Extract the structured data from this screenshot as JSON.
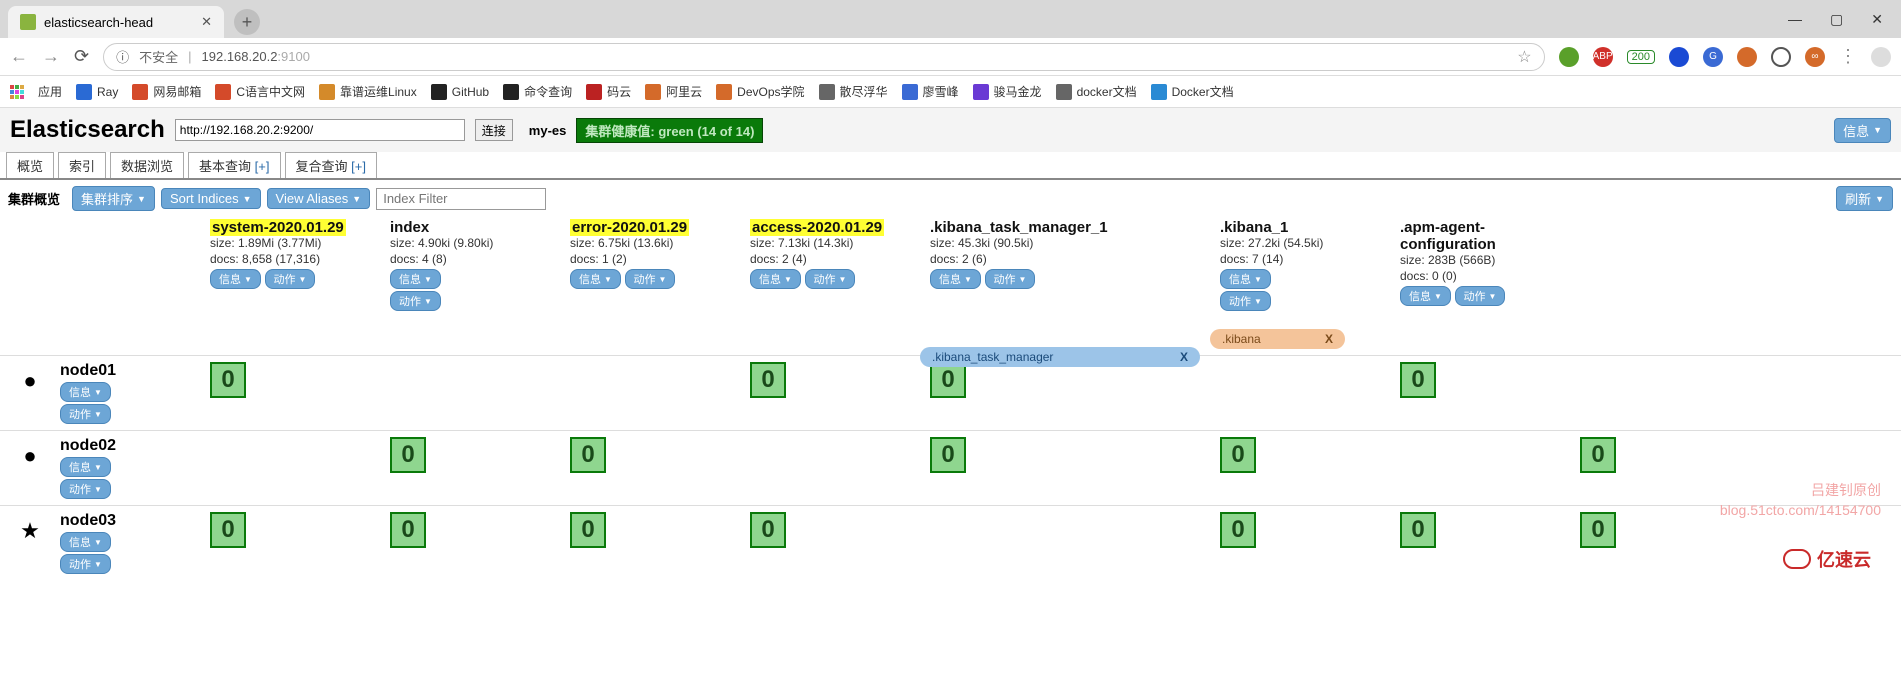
{
  "browser": {
    "tab_title": "elasticsearch-head",
    "url_warn": "不安全",
    "url_host": "192.168.20.2",
    "url_port": ":9100",
    "star": "☆",
    "ext_badge": "200",
    "bookmarks_label": "应用",
    "bookmarks": [
      {
        "label": "Ray",
        "color": "#2a6ad4"
      },
      {
        "label": "网易邮箱",
        "color": "#d44a2a"
      },
      {
        "label": "C语言中文网",
        "color": "#d44a2a"
      },
      {
        "label": "靠谱运维Linux",
        "color": "#d48a2a"
      },
      {
        "label": "GitHub",
        "color": "#222"
      },
      {
        "label": "命令查询",
        "color": "#222"
      },
      {
        "label": "码云",
        "color": "#b22"
      },
      {
        "label": "阿里云",
        "color": "#d46a2a"
      },
      {
        "label": "DevOps学院",
        "color": "#d46a2a"
      },
      {
        "label": "散尽浮华",
        "color": "#666"
      },
      {
        "label": "廖雪峰",
        "color": "#3a6ad4"
      },
      {
        "label": "骏马金龙",
        "color": "#6a3ad4"
      },
      {
        "label": "docker文档",
        "color": "#666"
      },
      {
        "label": "Docker文档",
        "color": "#2a8ad4"
      }
    ]
  },
  "es": {
    "title": "Elasticsearch",
    "url": "http://192.168.20.2:9200/",
    "connect": "连接",
    "cluster": "my-es",
    "health": "集群健康值: green (14 of 14)",
    "info_btn": "信息",
    "tabs": [
      "概览",
      "索引",
      "数据浏览",
      "基本查询 [+]",
      "复合查询 [+]"
    ],
    "controls": {
      "label": "集群概览",
      "sort_cluster": "集群排序",
      "sort_indices": "Sort Indices",
      "view_aliases": "View Aliases",
      "filter_placeholder": "Index Filter",
      "refresh": "刷新"
    },
    "btn_info": "信息",
    "btn_action": "动作",
    "indices": [
      {
        "name": "system-2020.01.29",
        "hl": true,
        "size": "size: 1.89Mi (3.77Mi)",
        "docs": "docs: 8,658 (17,316)",
        "both": true
      },
      {
        "name": "index",
        "hl": false,
        "size": "size: 4.90ki (9.80ki)",
        "docs": "docs: 4 (8)",
        "both": false
      },
      {
        "name": "error-2020.01.29",
        "hl": true,
        "size": "size: 6.75ki (13.6ki)",
        "docs": "docs: 1 (2)",
        "both": true
      },
      {
        "name": "access-2020.01.29",
        "hl": true,
        "size": "size: 7.13ki (14.3ki)",
        "docs": "docs: 2 (4)",
        "both": true
      },
      {
        "name": ".kibana_task_manager_1",
        "hl": false,
        "size": "size: 45.3ki (90.5ki)",
        "docs": "docs: 2 (6)",
        "both": true,
        "wide": true
      },
      {
        "name": ".kibana_1",
        "hl": false,
        "size": "size: 27.2ki (54.5ki)",
        "docs": "docs: 7 (14)",
        "both": false,
        "extra_action": true
      },
      {
        "name": ".apm-agent-configuration",
        "hl": false,
        "size": "size: 283B (566B)",
        "docs": "docs: 0 (0)",
        "both": true
      }
    ],
    "aliases": [
      {
        "name": ".kibana_task_manager",
        "x": "X"
      },
      {
        "name": ".kibana",
        "x": "X"
      }
    ],
    "nodes": [
      {
        "name": "node01",
        "bullet": "●",
        "shards": [
          0,
          null,
          null,
          0,
          0,
          null,
          0,
          null
        ]
      },
      {
        "name": "node02",
        "bullet": "●",
        "shards": [
          null,
          0,
          0,
          null,
          0,
          0,
          null,
          0
        ]
      },
      {
        "name": "node03",
        "bullet": "★",
        "shards": [
          0,
          0,
          0,
          0,
          null,
          0,
          0,
          0
        ]
      }
    ]
  },
  "watermark": {
    "l1": "吕建钊原创",
    "l2": "blog.51cto.com/14154700"
  },
  "brand": "亿速云"
}
